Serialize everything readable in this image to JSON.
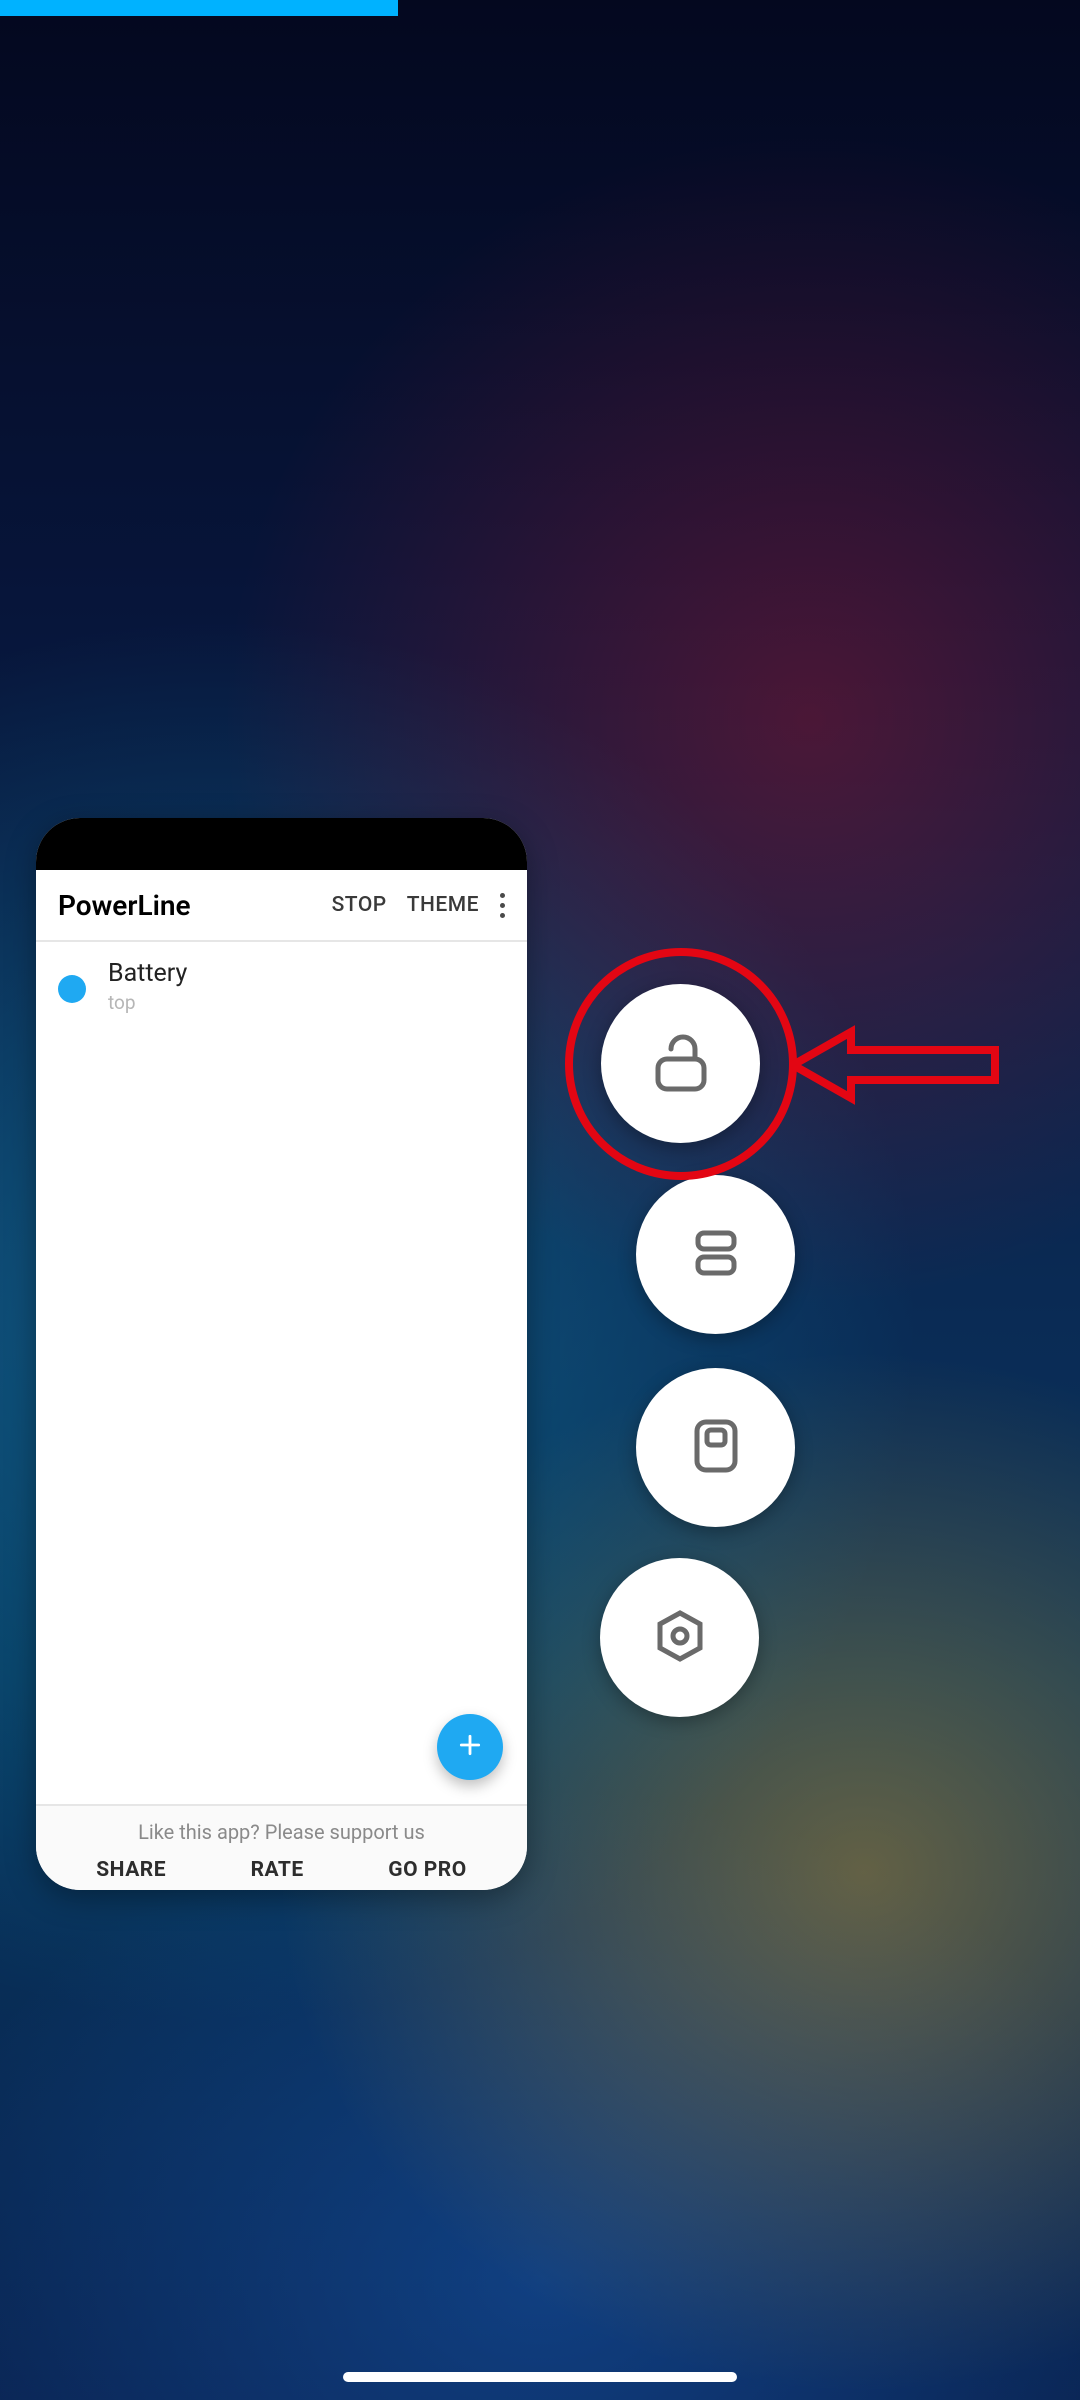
{
  "colors": {
    "accent": "#1fa9f2",
    "indicator": "#00b2ff",
    "annotation": "#e30613"
  },
  "app_card": {
    "title": "PowerLine",
    "actions": {
      "stop": "STOP",
      "theme": "THEME"
    },
    "list": [
      {
        "title": "Battery",
        "subtitle": "top",
        "dot_color": "#1fa9f2"
      }
    ],
    "fab_icon": "plus-icon",
    "footer": {
      "support_text": "Like this app? Please support us",
      "buttons": {
        "share": "SHARE",
        "rate": "RATE",
        "go_pro": "GO PRO"
      }
    }
  },
  "float_buttons": [
    {
      "name": "lock-button",
      "icon": "unlock-icon"
    },
    {
      "name": "split-button",
      "icon": "split-screen-icon"
    },
    {
      "name": "window-button",
      "icon": "floating-window-icon"
    },
    {
      "name": "settings-button",
      "icon": "hex-settings-icon"
    }
  ],
  "annotation": {
    "target": "lock-button",
    "shape": "circle",
    "arrow": "left"
  }
}
